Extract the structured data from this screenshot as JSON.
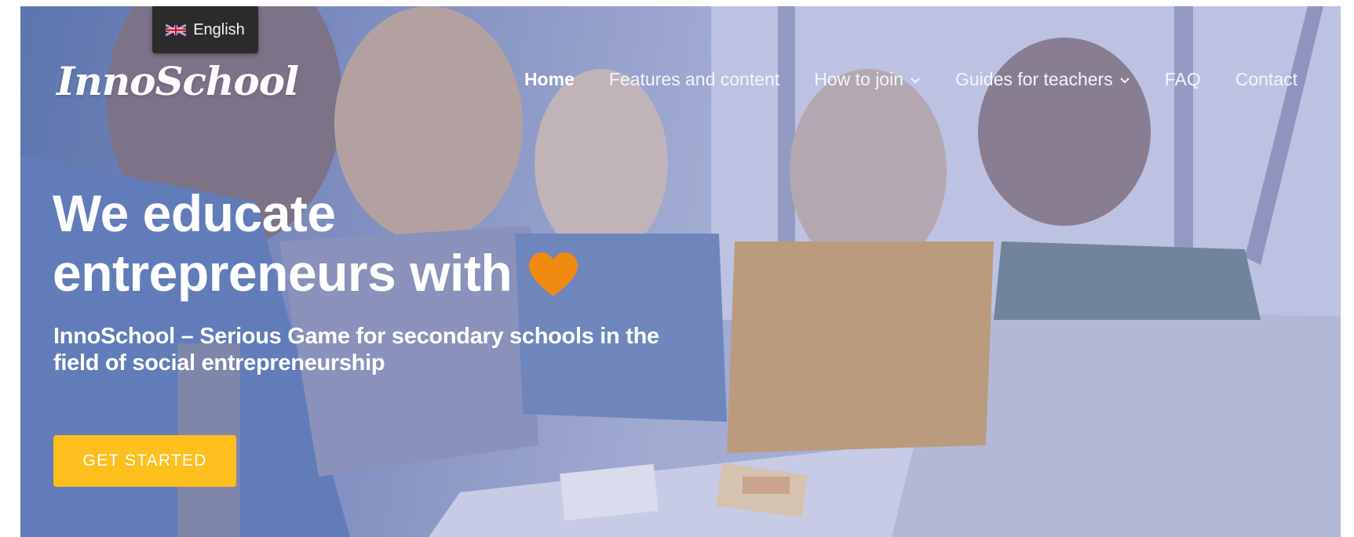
{
  "language_switcher": {
    "flag_icon": "uk-flag-icon",
    "label": "English"
  },
  "brand": {
    "logo_text": "InnoSchool"
  },
  "nav": {
    "items": [
      {
        "label": "Home",
        "active": true,
        "has_dropdown": false
      },
      {
        "label": "Features and content",
        "active": false,
        "has_dropdown": false
      },
      {
        "label": "How to join",
        "active": false,
        "has_dropdown": true
      },
      {
        "label": "Guides for teachers",
        "active": false,
        "has_dropdown": true
      },
      {
        "label": "FAQ",
        "active": false,
        "has_dropdown": false
      },
      {
        "label": "Contact",
        "active": false,
        "has_dropdown": false
      }
    ]
  },
  "hero": {
    "headline_line1": "We educate",
    "headline_line2": "entrepreneurs with",
    "heart_icon": "heart-icon",
    "subtitle": "InnoSchool – Serious Game for secondary schools in the field of social entrepreneurship",
    "cta_label": "GET STARTED"
  },
  "colors": {
    "cta": "#fcbf1e",
    "heart": "#f18a10",
    "overlay": "#aab0d8",
    "lang_bg": "#2b2b2b"
  }
}
